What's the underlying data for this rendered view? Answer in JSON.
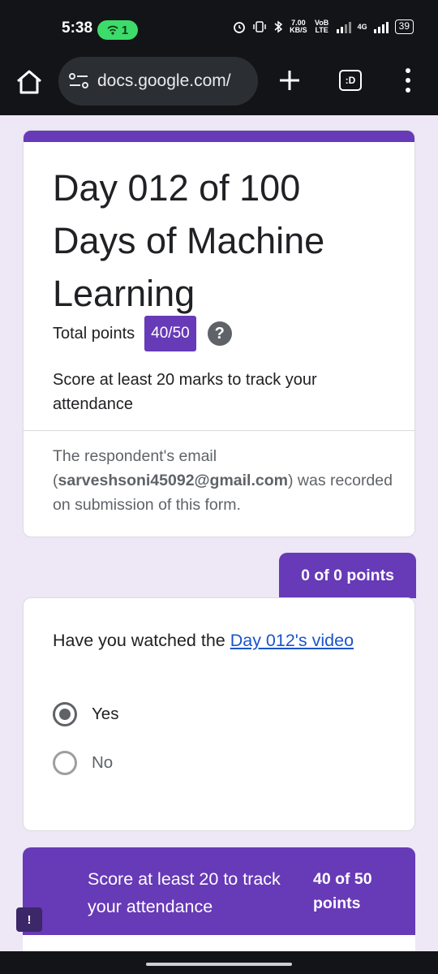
{
  "status_bar": {
    "time": "5:38",
    "hotspot_count": "1",
    "network_speed_value": "7.00",
    "network_speed_unit": "KB/S",
    "volte_label": "VoB LTE",
    "network_type": "4G",
    "battery": "39"
  },
  "browser": {
    "url": "docs.google.com/",
    "tabs_label": ":D"
  },
  "form": {
    "title": "Day 012 of 100 Days of Machine Learning",
    "total_points_label": "Total points",
    "total_points_value": "40/50",
    "help_glyph": "?",
    "score_note": "Score at least 20 marks to track your attendance",
    "email_prefix": "The respondent's email (",
    "email": "sarveshsoni45092@gmail.com",
    "email_suffix": ") was recorded on submission of this form."
  },
  "section1": {
    "points": "0 of 0 points",
    "question_prefix": "Have you watched the ",
    "question_link": "Day 012's video",
    "options": [
      {
        "label": "Yes",
        "selected": true
      },
      {
        "label": "No",
        "selected": false
      }
    ]
  },
  "section2": {
    "title": "Score at least 20 to track your attendance",
    "points": "40 of 50 points"
  },
  "feedback": {
    "glyph": "!"
  }
}
